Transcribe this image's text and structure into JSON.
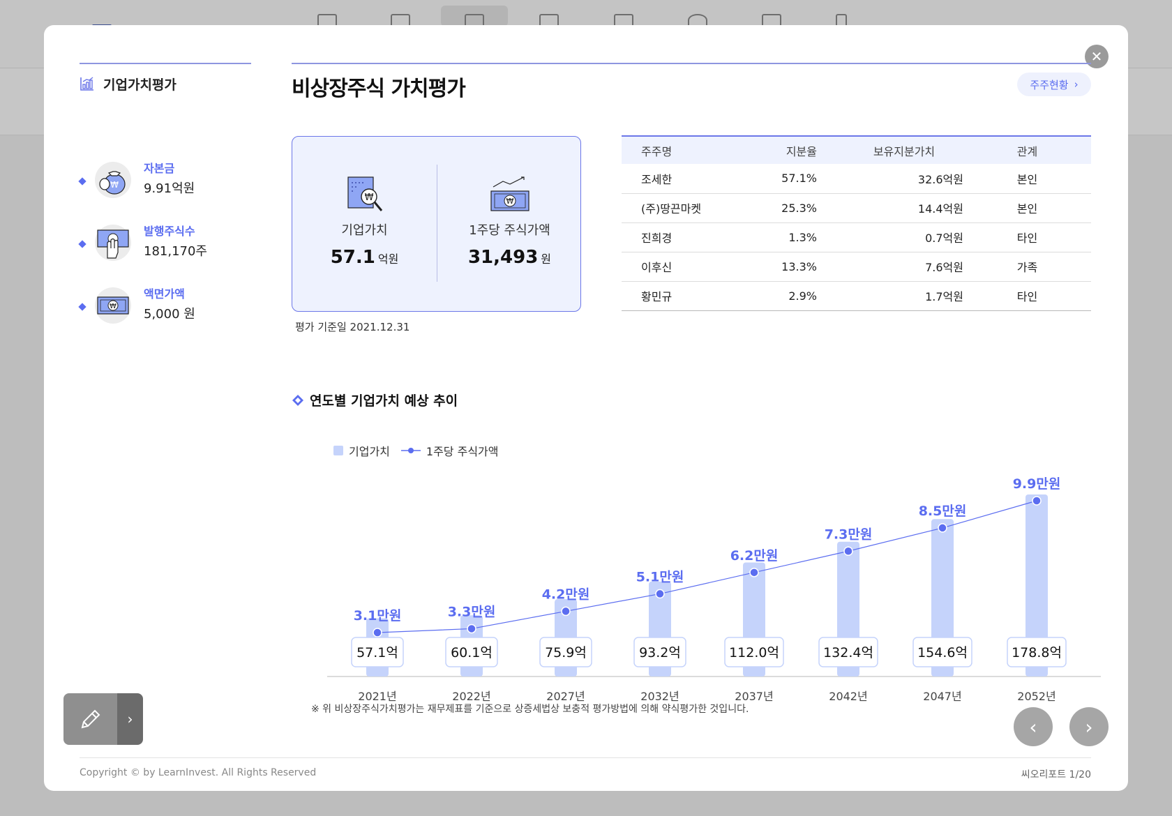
{
  "sidebar": {
    "title": "기업가치평가",
    "items": [
      {
        "label": "자본금",
        "value": "9.91억원",
        "icon": "money-bag-icon"
      },
      {
        "label": "발행주식수",
        "value": "181,170주",
        "icon": "hand-cash-icon"
      },
      {
        "label": "액면가액",
        "value": "5,000 원",
        "icon": "banknote-icon"
      }
    ]
  },
  "main": {
    "title": "비상장주식 가치평가",
    "shareholder_button": "주주현황"
  },
  "valuation": {
    "company_value_label": "기업가치",
    "company_value": "57.1",
    "company_value_unit": "억원",
    "share_price_label": "1주당 주식가액",
    "share_price": "31,493",
    "share_price_unit": "원",
    "eval_date": "평가 기준일 2021.12.31"
  },
  "shareholders": {
    "headers": [
      "주주명",
      "지분율",
      "보유지분가치",
      "관계"
    ],
    "rows": [
      [
        "조세한",
        "57.1%",
        "32.6억원",
        "본인"
      ],
      [
        "(주)땅끈마켓",
        "25.3%",
        "14.4억원",
        "본인"
      ],
      [
        "진희경",
        "1.3%",
        "0.7억원",
        "타인"
      ],
      [
        "이후신",
        "13.3%",
        "7.6억원",
        "가족"
      ],
      [
        "황민규",
        "2.9%",
        "1.7억원",
        "타인"
      ]
    ]
  },
  "chart_section": {
    "title": "연도별 기업가치 예상 추이",
    "legend_bar": "기업가치",
    "legend_line": "1주당 주식가액",
    "footnote": "※ 위 비상장주식가치평가는 재무제표를 기준으로 상증세법상 보충적 평가방법에 의해 약식평가한 것입니다."
  },
  "chart_data": {
    "type": "bar",
    "categories": [
      "2021년",
      "2022년",
      "2027년",
      "2032년",
      "2037년",
      "2042년",
      "2047년",
      "2052년"
    ],
    "series": [
      {
        "name": "기업가치",
        "type": "bar",
        "values": [
          57.1,
          60.1,
          75.9,
          93.2,
          112.0,
          132.4,
          154.6,
          178.8
        ],
        "labels": [
          "57.1억",
          "60.1억",
          "75.9억",
          "93.2억",
          "112.0억",
          "132.4억",
          "154.6억",
          "178.8억"
        ]
      },
      {
        "name": "1주당 주식가액",
        "type": "line",
        "values": [
          3.1,
          3.3,
          4.2,
          5.1,
          6.2,
          7.3,
          8.5,
          9.9
        ],
        "labels": [
          "3.1만원",
          "3.3만원",
          "4.2만원",
          "5.1만원",
          "6.2만원",
          "7.3만원",
          "8.5만원",
          "9.9만원"
        ]
      }
    ],
    "bar_color": "#c5d3fb",
    "line_color": "#5b6df0"
  },
  "footer": {
    "copyright": "Copyright © by  LearnInvest. All  Rights Reserved",
    "page": "씨오리포트 1/20"
  },
  "colors": {
    "accent": "#5b6df0",
    "card_bg": "#eef2fe"
  }
}
